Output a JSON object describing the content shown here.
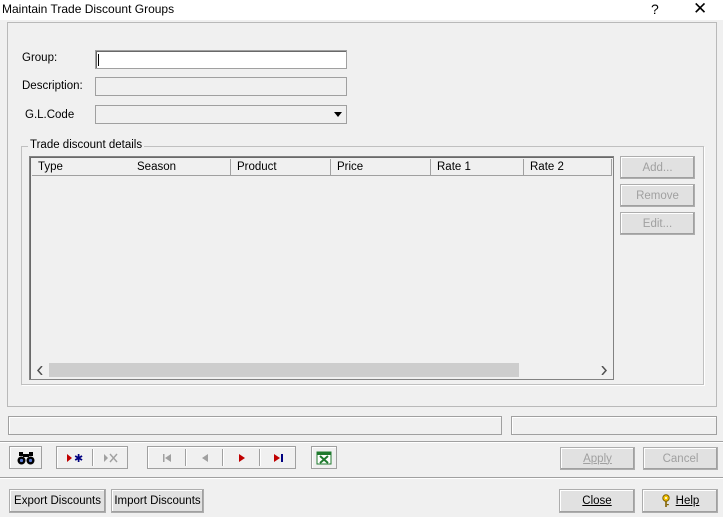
{
  "window": {
    "title": "Maintain Trade Discount Groups",
    "help_glyph": "?",
    "close_glyph": "✕"
  },
  "form": {
    "group_label": "Group:",
    "group_value": "",
    "description_label": "Description:",
    "description_value": "",
    "gl_code_label": "G.L.Code",
    "gl_code_value": ""
  },
  "details": {
    "legend": "Trade discount details",
    "columns": [
      "Type",
      "Season",
      "Product",
      "Price",
      "Rate 1",
      "Rate 2"
    ],
    "rows": [],
    "buttons": {
      "add": "Add...",
      "remove": "Remove",
      "edit": "Edit..."
    }
  },
  "toolbar": {
    "find_icon": "binoculars-icon",
    "new_icon": "new-record-icon",
    "delete_icon": "delete-record-icon",
    "first_icon": "first-record-icon",
    "prev_icon": "previous-record-icon",
    "next_icon": "next-record-icon",
    "last_icon": "last-record-icon",
    "excel_icon": "excel-export-icon"
  },
  "actions": {
    "apply": "Apply",
    "cancel": "Cancel",
    "export_discounts": "Export Discounts",
    "import_discounts": "Import Discounts",
    "close": "Close",
    "help": "Help"
  },
  "colors": {
    "background": "#f0f0f0",
    "nav_arrow_red": "#c00000",
    "nav_arrow_navy": "#000080",
    "excel_green": "#1f7a2e"
  }
}
